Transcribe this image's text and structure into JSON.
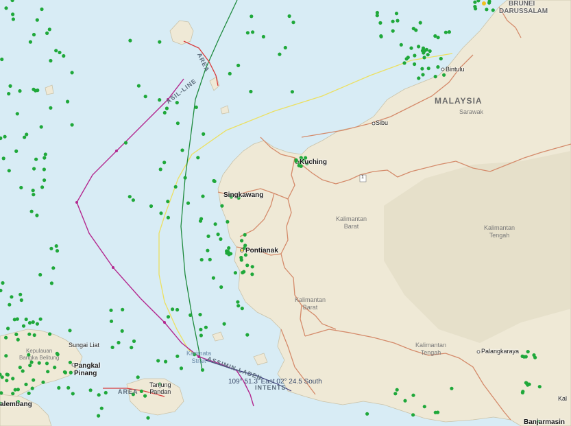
{
  "labels": {
    "brunei": "BRUNEI",
    "darussalam": "DARUSSALAM",
    "malaysia": "MALAYSIA",
    "sarawak": "Sarawak",
    "kuching": "Kuching",
    "sibu": "Sibu",
    "bintulu": "Bintulu",
    "singkawang": "Singkawang",
    "pontianak": "Pontianak",
    "kalbar1": "Kalimantan\nBarat",
    "kalbar2": "Kalimantan\nBarat",
    "kalteng1": "Kalimantan\nTengah",
    "kalteng2": "Kalimantan\nTengah",
    "palangkaraya": "Palangkaraya",
    "banjarmasin": "Banjarmasin",
    "kepulauan": "Kepulauan\nBangka Belitung",
    "sungailiat": "Sungai Liat",
    "pangkalpinang": "Pangkal\nPinang",
    "tanjungpandan": "Tanjung\nPandan",
    "palembang": "alembang",
    "karimata": "Karimata\nStrait",
    "kal_edge": "Kal",
    "asil_line": "ASIL-LINE",
    "area_top": "AREA",
    "area_bottom": "AREA",
    "assimin": "ASSIMIN-LADEN",
    "intents": "INTENTS",
    "coord_readout": "109° 51.3' East 02° 24.5 South",
    "road_shield": "1"
  },
  "colors": {
    "sea": "#d8ecf5",
    "land": "#efe9d8",
    "ship": "#1fa83a",
    "border": "#d48a6a",
    "line_magenta": "#b3288f",
    "line_green": "#1d8a3d",
    "line_yellow": "#f0e060",
    "line_red": "#d83a3a"
  }
}
